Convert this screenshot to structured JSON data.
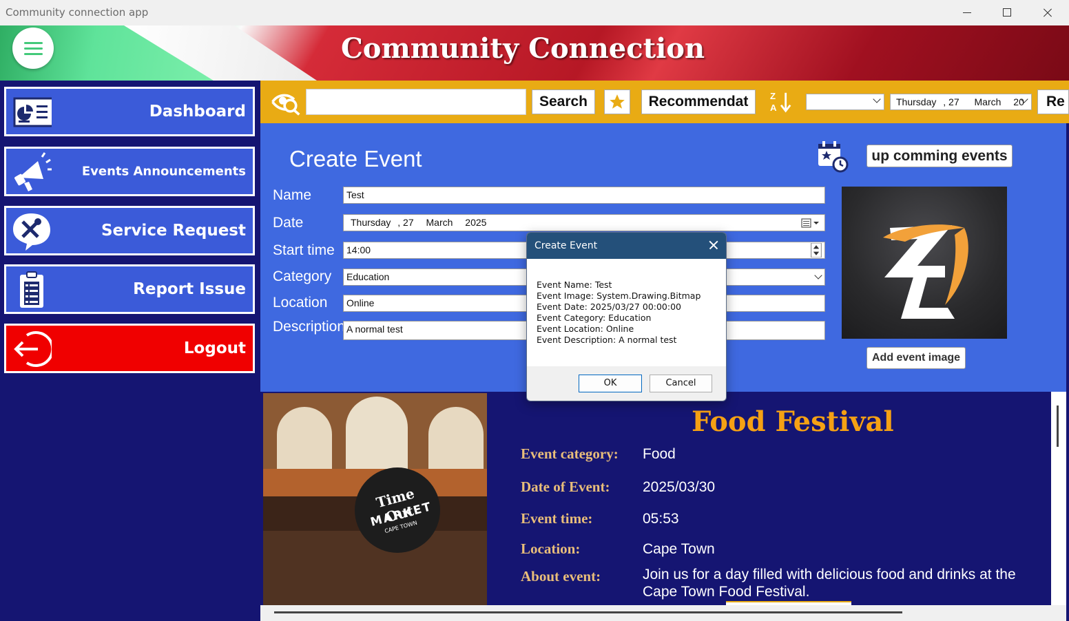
{
  "window": {
    "title": "Community connection app"
  },
  "header": {
    "title": "Community Connection"
  },
  "sidebar": {
    "items": [
      {
        "label": "Dashboard"
      },
      {
        "label": "Events Announcements"
      },
      {
        "label": "Service Request"
      },
      {
        "label": "Report Issue"
      },
      {
        "label": "Logout"
      }
    ]
  },
  "toolbar": {
    "search_label": "Search",
    "recommend_label": "Recommendat",
    "sort_icon_text": "Z↓A",
    "date_combo": {
      "day": "Thursday",
      "num": ", 27",
      "month": "March",
      "year": "20"
    },
    "re_label": "Re"
  },
  "form": {
    "title": "Create Event",
    "upcoming_label": "up comming events",
    "add_image_label": "Add event image",
    "labels": {
      "name": "Name",
      "date": "Date",
      "start_time": "Start time",
      "category": "Category",
      "location": "Location",
      "description": "Description"
    },
    "values": {
      "name": "Test",
      "date_day": "Thursday",
      "date_num": ", 27",
      "date_month": "March",
      "date_year": "2025",
      "start_time": "14:00",
      "category": "Education",
      "location": "Online",
      "description": "A normal test"
    }
  },
  "dialog": {
    "title": "Create Event",
    "lines": [
      "Event Name: Test",
      "Event Image: System.Drawing.Bitmap",
      "Event Date: 2025/03/27 00:00:00",
      "Event Category: Education",
      "Event Location: Online",
      "Event Description: A normal test"
    ],
    "ok_label": "OK",
    "cancel_label": "Cancel"
  },
  "feature": {
    "title": "Food Festival",
    "image_text": {
      "line1": "Time Out",
      "line2": "MARKET",
      "line3": "CAPE TOWN"
    },
    "labels": {
      "category": "Event category:",
      "date": "Date of Event:",
      "time": "Event time:",
      "location": "Location:",
      "about": "About event:"
    },
    "values": {
      "category": "Food",
      "date": "2025/03/30",
      "time": "05:53",
      "location": "Cape Town",
      "about": "Join us for a day filled with delicious food and drinks at the Cape Town Food Festival."
    }
  },
  "colors": {
    "sidebar_bg": "#151572",
    "nav_button": "#3b5bd9",
    "logout": "#f00000",
    "toolbar": "#e9ab14",
    "panel": "#3f69e0",
    "feature_title": "#f5a114",
    "feature_label": "#e8bd7a",
    "dialog_header": "#24507a"
  }
}
